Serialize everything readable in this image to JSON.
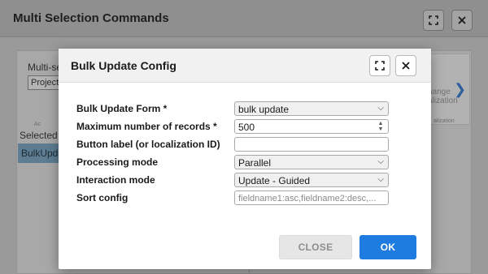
{
  "background": {
    "window_title": "Multi Selection Commands",
    "multi_select_label": "Multi-se",
    "project_select_value": "Project",
    "tiny_label": "Ac",
    "selected_label": "Selected C",
    "list_item": "BulkUpda",
    "card_text_line1": "hange",
    "card_text_line2": "alization",
    "card_tiny": "alization"
  },
  "modal": {
    "title": "Bulk Update Config",
    "rows": [
      {
        "label": "Bulk Update Form *",
        "value": "bulk update"
      },
      {
        "label": "Maximum number of records *",
        "value": "500"
      },
      {
        "label": "Button label (or localization ID)",
        "value": ""
      },
      {
        "label": "Processing mode",
        "value": "Parallel"
      },
      {
        "label": "Interaction mode",
        "value": "Update - Guided"
      },
      {
        "label": "Sort config",
        "placeholder": "fieldname1:asc,fieldname2:desc,..."
      }
    ],
    "close_button": "CLOSE",
    "ok_button": "OK"
  },
  "icons": [
    "expand-icon",
    "close-icon",
    "chevron-down-icon",
    "spinner-icon",
    "chevron-right-icon"
  ],
  "colors": {
    "primary": "#1e7be0",
    "overlay": "#9a9a9a"
  }
}
